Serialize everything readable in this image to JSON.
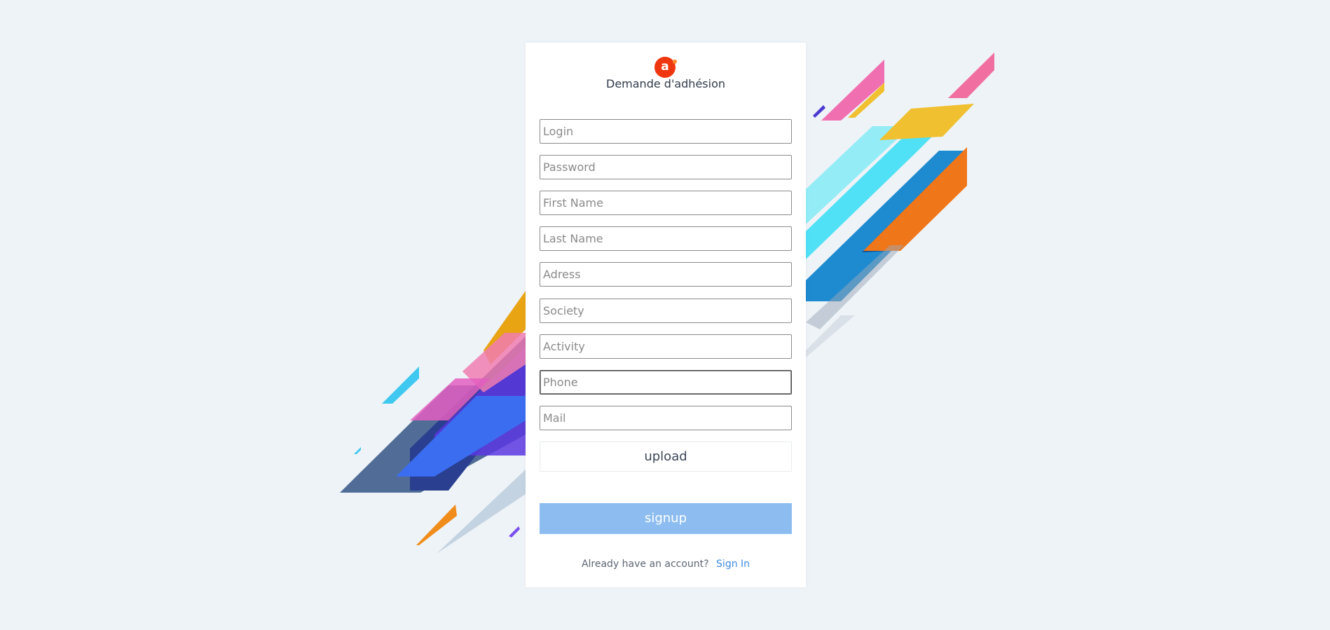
{
  "form": {
    "title": "Demande d'adhésion",
    "logo_letter": "a",
    "fields": [
      {
        "name": "login",
        "placeholder": "Login",
        "value": ""
      },
      {
        "name": "password",
        "placeholder": "Password",
        "value": ""
      },
      {
        "name": "first-name",
        "placeholder": "First Name",
        "value": ""
      },
      {
        "name": "last-name",
        "placeholder": "Last Name",
        "value": ""
      },
      {
        "name": "adress",
        "placeholder": "Adress",
        "value": ""
      },
      {
        "name": "society",
        "placeholder": "Society",
        "value": ""
      },
      {
        "name": "activity",
        "placeholder": "Activity",
        "value": ""
      },
      {
        "name": "phone",
        "placeholder": "Phone",
        "value": ""
      },
      {
        "name": "mail",
        "placeholder": "Mail",
        "value": ""
      }
    ],
    "upload_label": "upload",
    "signup_label": "signup",
    "footer_text": "Already have an account?",
    "signin_label": "Sign In"
  },
  "colors": {
    "background": "#eef3f7",
    "logo": "#f0360e",
    "signup_button": "#8dbcf0",
    "link": "#3f8ae0"
  }
}
